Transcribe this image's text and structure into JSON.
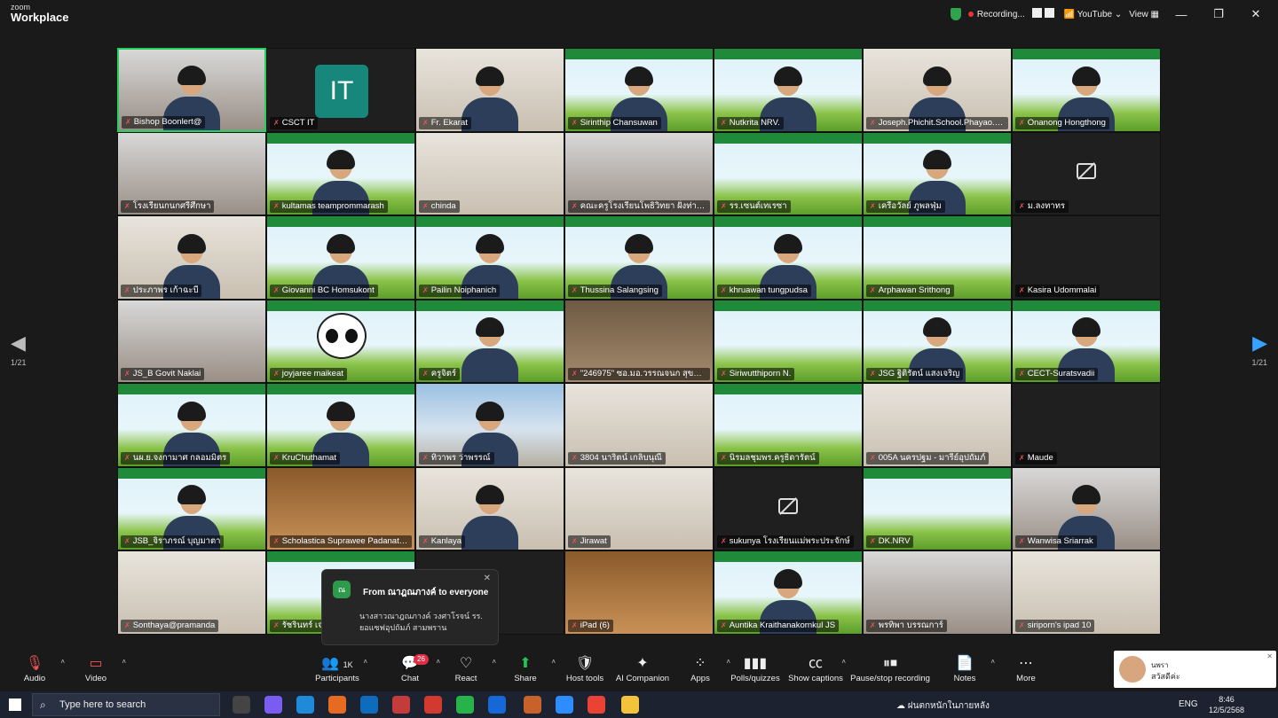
{
  "app": {
    "logo_top": "zoom",
    "logo_bottom": "Workplace"
  },
  "titlebar": {
    "recording": "Recording...",
    "youtube": "YouTube",
    "view": "View"
  },
  "pages": {
    "left": "1/21",
    "right": "1/21"
  },
  "tiles": [
    {
      "name": "Bishop Boonlert@",
      "bg": "room",
      "active": true,
      "person": true
    },
    {
      "name": "CSCT IT",
      "bg": "dark",
      "initials": "IT"
    },
    {
      "name": "Fr. Ekarat",
      "bg": "wall",
      "person": true
    },
    {
      "name": "Sirinthip Chansuwan",
      "bg": "green",
      "person": true
    },
    {
      "name": "Nutkrita NRV.",
      "bg": "green",
      "person": true
    },
    {
      "name": "Joseph.Phichit.School.Phayao.Ch...",
      "bg": "wall",
      "person": true
    },
    {
      "name": "Onanong Hongthong",
      "bg": "green",
      "person": true
    },
    {
      "name": "โรงเรียนกนกศรีศึกษา",
      "bg": "room"
    },
    {
      "name": "kultamas teamprommarash",
      "bg": "green",
      "person": true
    },
    {
      "name": "chinda",
      "bg": "wall"
    },
    {
      "name": "คณะครูโรงเรียนโพธิวิทยา ฝั่งท่าพร...",
      "bg": "room"
    },
    {
      "name": "รร.เซนต์เทเรซา",
      "bg": "green"
    },
    {
      "name": "เครือวัลย์ ภูพลฟุ่ม",
      "bg": "green",
      "person": true
    },
    {
      "name": "ม.ลงทาทร",
      "bg": "dark",
      "camoff": true
    },
    {
      "name": "ประภาพร เก้าฉะบี",
      "bg": "wall",
      "person": true
    },
    {
      "name": "Giovanni BC Homsukont",
      "bg": "green",
      "person": true
    },
    {
      "name": "Pailin Noiphanich",
      "bg": "green",
      "person": true
    },
    {
      "name": "Thussina Salangsing",
      "bg": "green",
      "person": true
    },
    {
      "name": "khruawan tungpudsa",
      "bg": "green",
      "person": true
    },
    {
      "name": "Arphawan Srithong",
      "bg": "green"
    },
    {
      "name": "Kasira Udommalai",
      "bg": "dark"
    },
    {
      "name": "JS_B Govit Naklai",
      "bg": "room"
    },
    {
      "name": "joyjaree maikeat",
      "bg": "green",
      "panda": true
    },
    {
      "name": "ครูจิตร์",
      "bg": "green",
      "person": true
    },
    {
      "name": "\"246975\" ซอ.มอ.วรรณจนก สุขวังค์...",
      "bg": "shelf"
    },
    {
      "name": "Siriwutthiporn N.",
      "bg": "green"
    },
    {
      "name": "JSG ฐิติรัตน์ แสงเจริญ",
      "bg": "green",
      "person": true
    },
    {
      "name": "CECT-Suratsvadii",
      "bg": "green",
      "person": true
    },
    {
      "name": "นผ.ย.จงกามาศ กลอมมิตร",
      "bg": "green",
      "person": true
    },
    {
      "name": "KruChuthamat",
      "bg": "green",
      "person": true
    },
    {
      "name": "ทิวาพร ว่าพรรณ์",
      "bg": "sky",
      "person": true
    },
    {
      "name": "3804 นาริตน์ เกลิบนุณี",
      "bg": "wall"
    },
    {
      "name": "นิรมลชุมพร.ครูธิดารัตน์",
      "bg": "green"
    },
    {
      "name": "005A นครปฐม - มารีย์อุปถัมภ์",
      "bg": "wall"
    },
    {
      "name": "Maude",
      "bg": "dark"
    },
    {
      "name": "JSB_จิราภรณ์ บุญมาตา",
      "bg": "green",
      "person": true
    },
    {
      "name": "Scholastica Suprawee Padanat (...",
      "bg": "brown"
    },
    {
      "name": "Kanlaya",
      "bg": "wall",
      "person": true
    },
    {
      "name": "Jirawat",
      "bg": "wall"
    },
    {
      "name": "sukunya โรงเรียนแม่พระประจักษ์",
      "bg": "dark",
      "camoff": true
    },
    {
      "name": "DK.NRV",
      "bg": "green"
    },
    {
      "name": "Wanwisa Sriarrak",
      "bg": "room",
      "person": true
    },
    {
      "name": "Sonthaya@pramanda",
      "bg": "wall"
    },
    {
      "name": "รัชรินทร์ เจ...",
      "bg": "green"
    },
    {
      "name": "",
      "bg": "dark"
    },
    {
      "name": "iPad (6)",
      "bg": "brown"
    },
    {
      "name": "Auntika Kraithanakornkul JS",
      "bg": "green",
      "person": true
    },
    {
      "name": "พรทิพา บรรณการ์",
      "bg": "room"
    },
    {
      "name": "siriporn's ipad 10",
      "bg": "wall"
    }
  ],
  "chat_popup": {
    "avatar": "ณ",
    "from": "From ณาฎณภางค์ to everyone",
    "message": "นางสาวณาฎณภางค์ วงศาโรจน์ รร. ยอแซฟอุปถัมภ์ สามพราน"
  },
  "toolbar": {
    "audio": "Audio",
    "video": "Video",
    "participants": "Participants",
    "participants_count": "1K",
    "chat": "Chat",
    "chat_badge": "26",
    "react": "React",
    "share": "Share",
    "host_tools": "Host tools",
    "ai_companion": "AI Companion",
    "apps": "Apps",
    "polls": "Polls/quizzes",
    "captions": "Show captions",
    "recording": "Pause/stop recording",
    "notes": "Notes",
    "more": "More"
  },
  "notification": {
    "title": "นพรา",
    "text": "สวัสดีค่ะ"
  },
  "taskbar": {
    "search_placeholder": "Type here to search",
    "weather": "ฝนตกหนักในภายหลัง",
    "lang": "ENG",
    "time": "8:46",
    "date": "12/5/2568"
  },
  "colors": {
    "active_speaker": "#23d160",
    "share": "#23c552",
    "accent_blue": "#35a3ff",
    "badge": "#e02f44"
  }
}
